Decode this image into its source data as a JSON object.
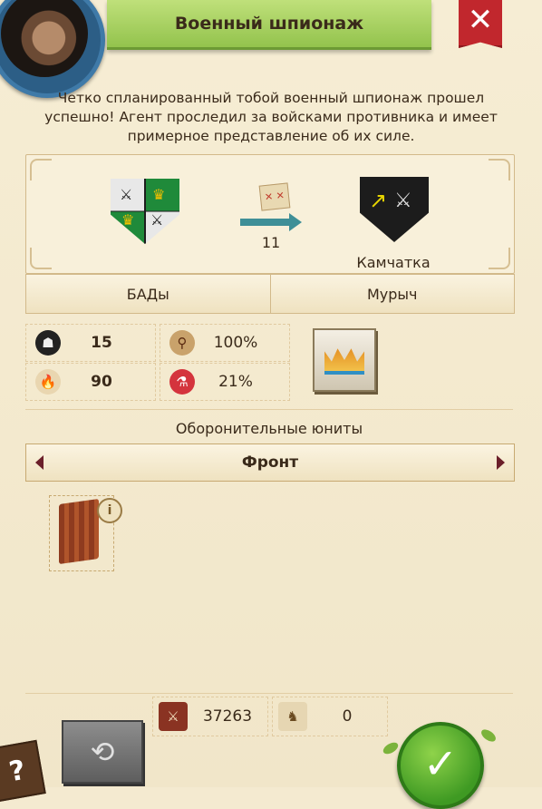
{
  "dialog": {
    "title": "Военный шпионаж",
    "close_icon": "close-icon",
    "description": "Четко спланированный тобой военный шпионаж прошел успешно! Агент проследил за войсками противника и имеет примерное представление об их силе."
  },
  "report": {
    "travel_time": "11",
    "target_name": "Камчатка",
    "attacker_player": "БАДы",
    "defender_player": "Мурыч"
  },
  "stats": {
    "spies": "15",
    "accuracy": "100%",
    "torches": "90",
    "risk": "21%"
  },
  "defense": {
    "section_label": "Оборонительные юниты",
    "flank_label": "Фронт",
    "info_label": "i"
  },
  "totals": {
    "attack_total": "37263",
    "defenders_count": "0"
  },
  "buttons": {
    "help_label": "?",
    "confirm_label": "✓"
  },
  "colors": {
    "title_banner": "#9ccd54",
    "close_button": "#c1272d",
    "confirm_button": "#3f9a23",
    "panel_border": "#d2b98a"
  }
}
